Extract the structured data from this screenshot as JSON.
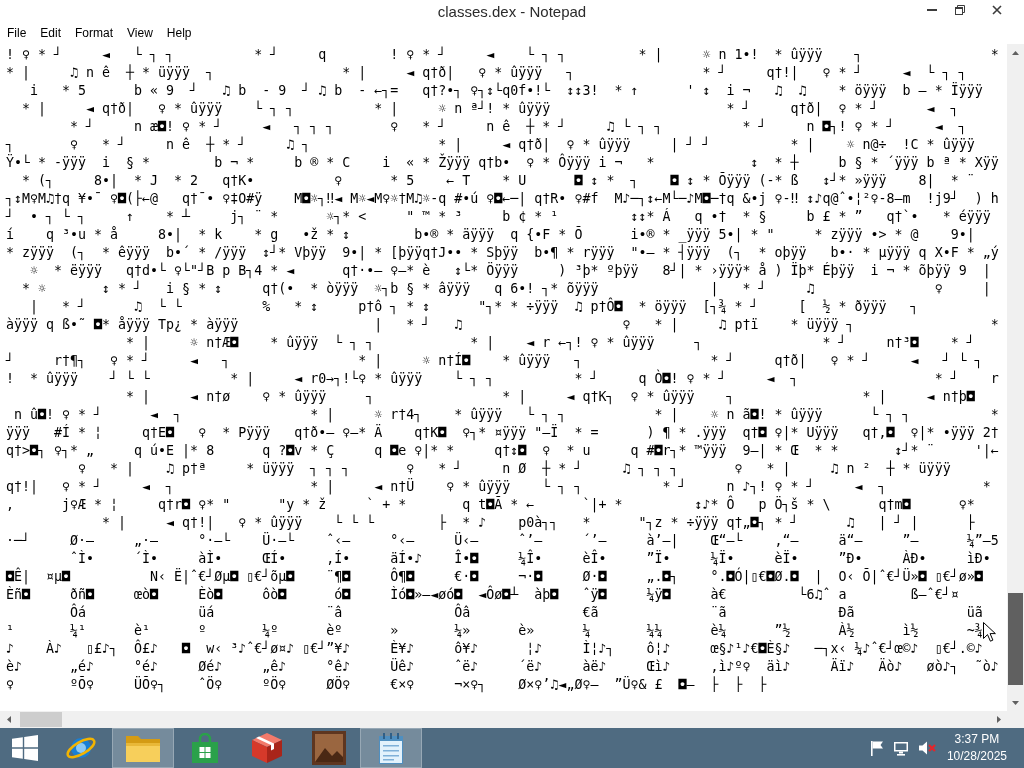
{
  "window": {
    "title": "classes.dex - Notepad"
  },
  "menu": [
    "File",
    "Edit",
    "Format",
    "View",
    "Help"
  ],
  "editor": {
    "lines": [
      "! ♀ * ┘     ◄   └ ┐ ┐          * ┘     q        ! ♀ * ┘     ◄    └ ┐ ┐         * |     ☼ n 1•!  * ûÿÿÿ    ┐                *",
      "* |     ♫ n ê  ┼ * üÿÿÿ  ┐                * |     ◄ q†ð|   ♀ * ûÿÿÿ   ┐                * ┘     q†!|   ♀ * ┘     ◄  └ ┐ ┐",
      "   i   * 5      b « 9  ┘   ♫ b  - 9  ┘ ♫ b  - ←┐=   q†?•┐ ♀┐↕└q0f•!└  ↕↕3!  * ↑      ' ↕  i ¬   ♫  ♫    * öÿÿÿ  b – * Ïÿÿÿ",
      "  * |     ◄ q†ð|   ♀ * ûÿÿÿ    └ ┐ ┐          * |     ☼ n ª┘! * ûÿÿÿ                      * ┘     q†ð|  ♀ * ┘      ◄  ┐",
      "        * ┘     n æ◘! ♀ * ┘     ◄   ┐ ┐ ┐       ♀   * ┘     n ê  ┼ * ┘     ♫ └ ┐ ┐          * ┘     n ◘┐! ♀ * ┘     ◄  ┐",
      "┐       ♀   * ┘     n ê  ┼ * ┘     ♫ ┐                * |     ◄ q†ð|  ♀ * ûÿÿÿ     | ┘ ┘          * |    ☼ n@÷  !C * ûÿÿÿ",
      "Ÿ•└ * -ÿÿÿ  i  § *        b ¬ *     b ® * C    i  « * Žÿÿÿ q†b•  ♀ * Ôÿÿÿ i ¬   *            ↕  * ┼     b § * ´ÿÿÿ b ª * Xÿÿ",
      "  * (┐     8•|  * J  * 2   q†K•          ♀      * 5    ← T    * U      ◘ ↕ *  ┐    ◘ ↕ * Õÿÿÿ (-* ß   ↕┘* »ÿÿÿ    8|  * ¨",
      "┐↕M♀M♫†q ¥•¯ ♀◘(├←@   q†¯• ♀‡O#ÿ    M◘☼┐‼◄ M☼◄M♀☼†M♫☼-q #•ú ♀◘←─| q†R• ♀#f  M♪─┐↕←M└─♪M◘─†q &•j ♀-‼ ↕♪q@ˆ•¦²♀-8–m  !j9┘  ) h",
      "┘  • ┐ └ ┐     ↑    * ┴     j┐ ¨ *      ☼┐* <     \" ™ * ³     b ¢ * ¹         ↕↕* Á   q •†  * §     b £ * ”   q†`•   * éÿÿÿ",
      "í    q ³•u * å     8•|  * k    * g   •ž * ↕        b•® * äÿÿÿ  q {•F * Õ      i•® * _ÿÿÿ 5•| * \"     * zÿÿÿ •> * @    9•|",
      "* zÿÿÿ  (┐  * êÿÿÿ  b•´ * /ÿÿÿ  ↕┘* Vþÿÿ  9•| * [þÿÿq†J•• * Sþÿÿ  b•¶ * rÿÿÿ  \"•— * ┤ÿÿÿ  (┐  * oþÿÿ   b•· * µÿÿÿ q X•F * „ý",
      "   ☼  * ëÿÿÿ   q†d•└ ♀└\"┘B p B┐4 * ◄      q†·•– ♀–* è   ↕└* Öÿÿÿ     ) ³þ* ºþÿÿ   8┘| * ›ÿÿÿ* å ) Ïþ* Éþÿÿ  i ¬ * õþÿÿ 9  |",
      "  * ☼       ↕ * ┘   i § * ↕     q†(•  * òÿÿÿ  ☼┐b § * âÿÿÿ   q 6•! ┐* õÿÿÿ              |   * ┘     ♫               ♀     |",
      "   |   * ┘      ♫  └ └          %   * ↕     p†ô ┐ * ↕      \"┐* * ÷ÿÿÿ  ♫ p†Ô◘  * öÿÿÿ  [┐¾ * ┘     [  ½ * ðÿÿÿ   ┐",
      "àÿÿÿ q ß•˜ ◘* åÿÿÿ Tp¿ * àÿÿÿ                 |   * ┘   ♫                    ♀   * |     ♫ p†ï    * üÿÿÿ ┐                 *",
      "               * |     ☼ n†Æ◘    * ûÿÿÿ  └ ┐ ┐            * |    ◄ r ←┐! ♀ * ûÿÿÿ     ┐               * ┘     n†³◘    * ┘",
      "┘     r†¶┐   ♀ * ┘     ◄   ┐                * |     ☼ n†Í◘    * ûÿÿÿ   ┐                * ┘     q†ð|   ♀ * ┘     ◄   ┘ └ ┐",
      "!  * ûÿÿÿ    ┘ └ └          * |     ◄ r0→┐!└♀ * ûÿÿÿ    └ ┐ ┐          * ┘     q Ò◘! ♀ * ┘     ◄  ┐                 * ┘    r",
      "               * |     ◄ n†ø    ♀ * ûÿÿÿ     ┐                * |     ◄ q†K┐  ♀ * ûÿÿÿ    ┐                * |     ◄ n†þ◘",
      " n û◘! ♀ * ┘      ◄  ┐                * |     ☼ r†4┐    * ûÿÿÿ   └ ┐ ┐           * |    ☼ n ã◘! * ûÿÿÿ      └ ┐ ┐          *",
      "ÿÿÿ   #Í * ¦     q†E◘   ♀  * Pÿÿÿ   q†ð•– ♀–* Ä    q†K◘  ♀┐* ¤ÿÿÿ \"–Ï  * =      ) ¶ * .ÿÿÿ  q†◘ ♀|* Uÿÿÿ   q†,◘  ♀|* •ÿÿÿ 2†",
      "q†>◘┐ ♀┐* „     q ú•E |* 8      q ?◘v * Ç     q ◘e ♀|* *     q†↕◘  ♀  * u     q #◘r┐* ™ÿÿÿ  9–| * Œ  * *       ↕┘* ¨     '|←",
      "         ♀   * |    ♫ p†ª     * üÿÿÿ  ┐ ┐ ┐       ♀   * ┘     n Ø  ┼ * ┘     ♫ ┐ ┐ ┐       ♀   * |     ♫ n ²  ┼ * üÿÿÿ",
      "q†!|   ♀ * ┘     ◄  ┐                 * |     ◄ n†Ü    ♀ * ûÿÿÿ    └ ┐ ┐          * ┘     n ♪┐! ♀ * ┘     ◄  ┐            *",
      ",      j♀Æ * ¦     q†r◘ ♀* \"      \"y * ž     ` + *       q t◘Ã * ←      `|+ *         ↕♪* Ô   p Ö┐š * \\      q†m◘      ♀*",
      "            * |     ◄ q†!|   ♀ * ûÿÿÿ    └ └ └        ├  * ♪    p0à┐┐   *      \"┐z * ÷ÿÿÿ q†„◘┐ * ┘      ♫   | ┘ |      ├",
      "·─┘     Ø·–     „·–     °·–└    Ü·–└    ˆ‹–     °‹–     Ü‹–     ˆ’–     ´’–     à’–|    Œ“–└    ‚“–     ä“–     ”–      ¼”–5",
      "        ˆÌ•     ´Ì•     àÌ•     ŒÍ•     ‚Í•     äÍ•♪    Î•◘     ¼Î•     èÎ•     ”Ï•     ¼Ï•     èÏ•     ”Ð•     ÀÐ•     ìÐ•",
      "◘Ê|  ¤µ◘          N‹ Ë|ˆ€┘Øµ◘ ▯€┘õµ◘    ¨¶◘     Ô¶◘     €·◘     ¬·◘     Ø·◘     „.◘┐    °.◘Ó|▯€◘Ø.◘  |  O‹ Õ|ˆ€┘Ü»◘ ▯€┘ø»◘",
      "Èñ◘     ðñ◘     œò◘     Èò◘     ôò◘      ó◘     Ìó◘»–◄øó◘  ◄Ôø◘┴  àþ◘   ˆÿ◘     ¼ÿ◘     à€         └6♫ˆ a        ß–ˆ€┘¤",
      "        Ôá              üá              ¨â              Ôâ              €ã              ¨ã              Ðã              üã",
      "¹       ¼¹      è¹      º       ¼º      èº      »       ¼»      è»      ¼       ¼¼      è¼      ”½      À½      ì½      ~¾",
      "♪    À♪   ▯£♪┐  Ô£♪   ◘  w‹ ³♪ˆ€┘ø¤♪ ▯€┘”¥♪     È¥♪     ô¥♪      ¦♪     Ì¦♪┐    ô¦♪     œ§♪¹♪€◘È§♪   ─┐x‹ ¼♪ˆ€┘œ©♪  ▯€┘.©♪",
      "è♪      „é♪     °é♪     Øé♪     „ê♪     °ê♪     Üê♪     ˆë♪     ´ë♪     àë♪     Œì♪     ‚ì♪º♀  äì♪     Äï♪   Äò♪   øò♪┐  ˜ò♪",
      "♀       ºÕ♀     ÜÕ♀┐    ˆÖ♀     ºÖ♀     ØÖ♀     €×♀     ¬×♀┐    Ø×♀’♫◄„Ø♀–  ”Ü♀& £  ◘–  ├  ├  ├"
    ]
  },
  "taskbar": {
    "apps": [
      {
        "kind": "browser",
        "running": false
      },
      {
        "kind": "folder",
        "running": true
      },
      {
        "kind": "store",
        "running": false
      },
      {
        "kind": "package",
        "running": false
      },
      {
        "kind": "picture",
        "running": false
      },
      {
        "kind": "notepad",
        "running": true
      }
    ],
    "tray": {
      "volume_muted": true
    },
    "clock": {
      "time": "3:37 PM",
      "date": "10/28/2025"
    }
  }
}
